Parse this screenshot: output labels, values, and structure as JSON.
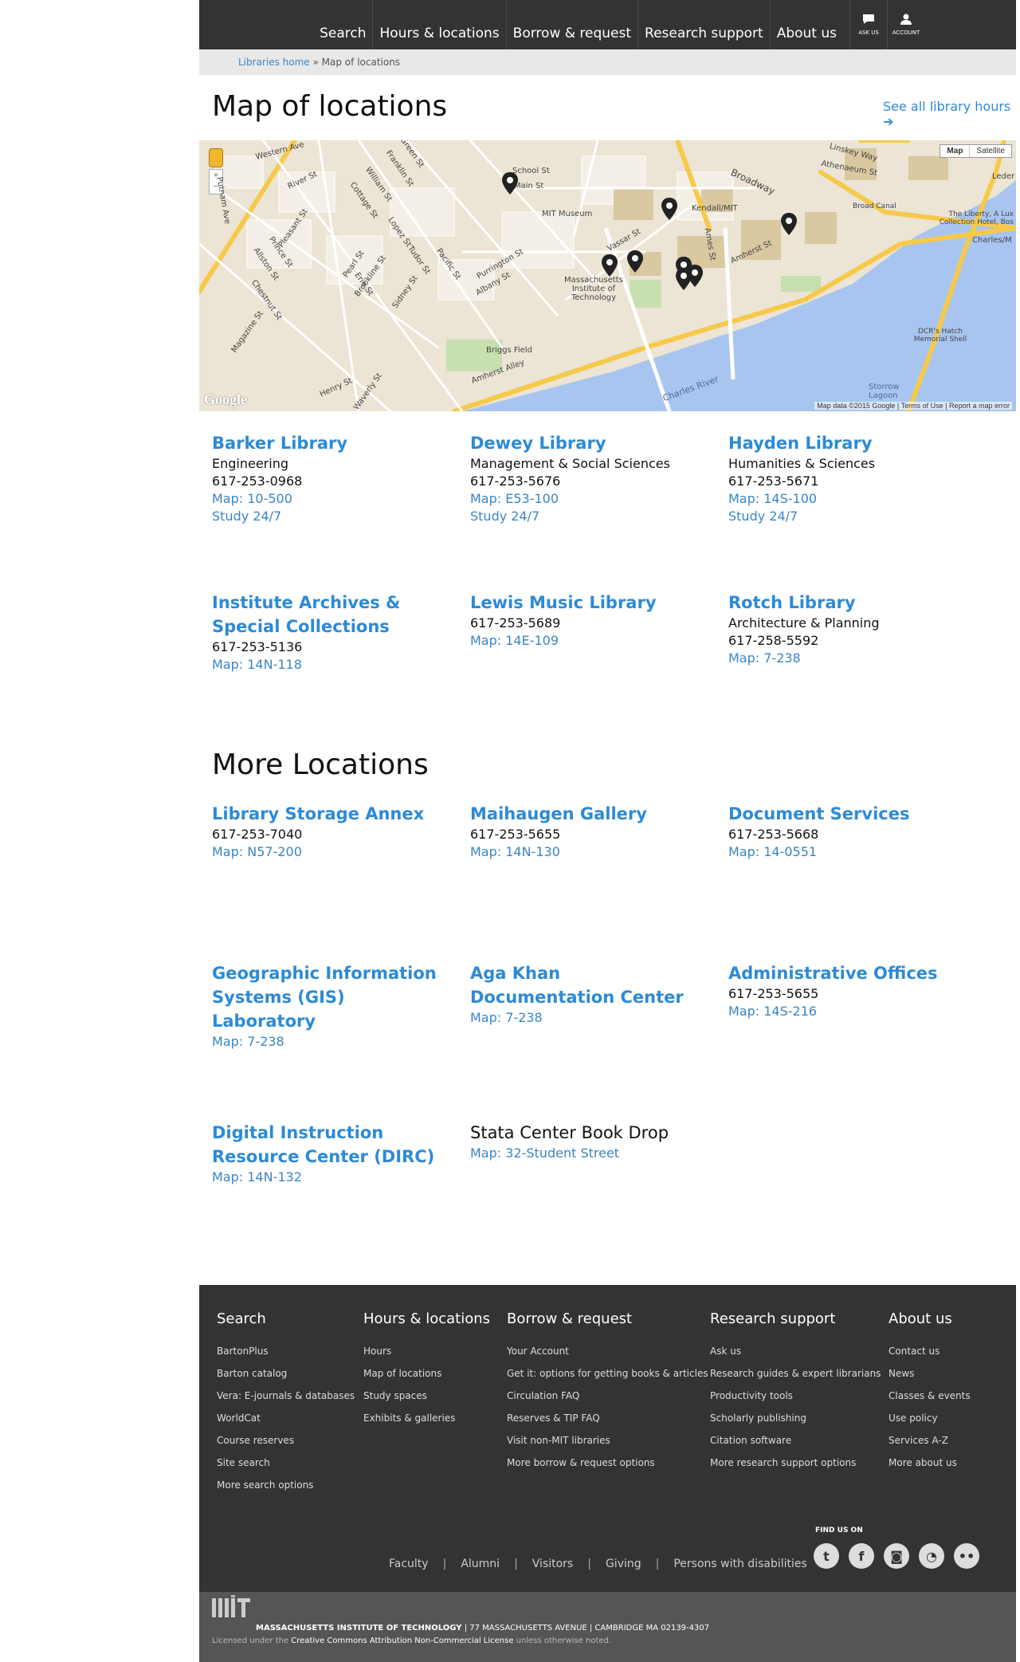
{
  "nav": {
    "items": [
      "Search",
      "Hours & locations",
      "Borrow & request",
      "Research support",
      "About us"
    ],
    "ask_us": "ASK US",
    "account": "ACCOUNT"
  },
  "breadcrumb": {
    "home": "Libraries home",
    "sep": "»",
    "current": "Map of locations"
  },
  "page_title": "Map of locations",
  "all_hours_link": "See all library hours",
  "map": {
    "toggle_map": "Map",
    "toggle_satellite": "Satellite",
    "credit": "Map data ©2015 Google | Terms of Use | Report a map error",
    "google": "Google",
    "labels": {
      "western_ave": "Western Ave",
      "river_st": "River St",
      "putnam_ave": "Putnam Ave",
      "pleasant_st": "Pleasant St",
      "prince_st": "Prince St",
      "allston_st": "Allston St",
      "chestnut_st": "Chestnut St",
      "magazine_st": "Magazine St",
      "green_st": "Green St",
      "franklin_st": "Franklin St",
      "william_st": "William St",
      "cottage_st": "Cottage St",
      "school_st": "School St",
      "main_st": "Main St",
      "mit_museum": "MIT Museum",
      "kendall": "Kendall/MIT",
      "broadway": "Broadway",
      "linskey": "Linskey Way",
      "athenaeum": "Athenaeum St",
      "broad_canal": "Broad Canal",
      "liberty": "The Liberty, A Lux Collection Hotel, Bos",
      "mit": "Massachusetts Institute of Technology",
      "vassar": "Vassar St",
      "amherst": "Amherst St",
      "ames": "Ames St",
      "purrington": "Purrington St",
      "albany": "Albany St",
      "briggs": "Briggs Field",
      "amherst_alley": "Amherst Alley",
      "charles_river": "Charles River",
      "dcr": "DCR's Hatch Memorial Shell",
      "storrow": "Storrow Lagoon",
      "charles_m": "Charles/M",
      "leder": "Leder",
      "henry": "Henry St",
      "waverly": "Waverly St",
      "brookline": "Brookline St",
      "sidney": "Sidney St",
      "pacific": "Pacific St",
      "tudor": "Tudor St",
      "pearl": "Pearl St",
      "erie": "Erie St",
      "lopez": "Lopez St"
    }
  },
  "libraries": [
    {
      "name": "Barker Library",
      "dept": "Engineering",
      "phone": "617-253-0968",
      "map": "Map: 10-500",
      "study": "Study 24/7"
    },
    {
      "name": "Dewey Library",
      "dept": "Management & Social Sciences",
      "phone": "617-253-5676",
      "map": "Map: E53-100",
      "study": "Study 24/7"
    },
    {
      "name": "Hayden Library",
      "dept": "Humanities & Sciences",
      "phone": "617-253-5671",
      "map": "Map: 14S-100",
      "study": "Study 24/7"
    },
    {
      "name": "Institute Archives & Special Collections",
      "phone": "617-253-5136",
      "map": "Map: 14N-118"
    },
    {
      "name": "Lewis Music Library",
      "phone": "617-253-5689",
      "map": "Map: 14E-109"
    },
    {
      "name": "Rotch Library",
      "dept": "Architecture & Planning",
      "phone": "617-258-5592",
      "map": "Map: 7-238"
    }
  ],
  "more_title": "More Locations",
  "more_locations": [
    {
      "name": "Library Storage Annex",
      "phone": "617-253-7040",
      "map": "Map: N57-200"
    },
    {
      "name": "Maihaugen Gallery",
      "phone": "617-253-5655",
      "map": "Map: 14N-130"
    },
    {
      "name": "Document Services",
      "phone": "617-253-5668",
      "map": "Map: 14-0551"
    },
    {
      "name": "Geographic Information Systems (GIS) Laboratory",
      "map": "Map: 7-238"
    },
    {
      "name": "Aga Khan Documentation Center",
      "map": "Map: 7-238"
    },
    {
      "name": "Administrative Offices",
      "phone": "617-253-5655",
      "map": "Map: 14S-216"
    },
    {
      "name": "Digital Instruction Resource Center (DIRC)",
      "map": "Map: 14N-132"
    },
    {
      "name": "Stata Center Book Drop",
      "map": "Map: 32-Student Street"
    }
  ],
  "footer": {
    "columns": [
      {
        "title": "Search",
        "links": [
          "BartonPlus",
          "Barton catalog",
          "Vera: E-journals & databases",
          "WorldCat",
          "Course reserves",
          "Site search",
          "More search options"
        ]
      },
      {
        "title": "Hours & locations",
        "links": [
          "Hours",
          "Map of locations",
          "Study spaces",
          "Exhibits & galleries"
        ]
      },
      {
        "title": "Borrow & request",
        "links": [
          "Your Account",
          "Get it: options for getting books & articles",
          "Circulation FAQ",
          "Reserves & TIP FAQ",
          "Visit non-MIT libraries",
          "More borrow & request options"
        ]
      },
      {
        "title": "Research support",
        "links": [
          "Ask us",
          "Research guides & expert librarians",
          "Productivity tools",
          "Scholarly publishing",
          "Citation software",
          "More research support options"
        ]
      },
      {
        "title": "About us",
        "links": [
          "Contact us",
          "News",
          "Classes & events",
          "Use policy",
          "Services A-Z",
          "More about us"
        ]
      }
    ],
    "audience_links": [
      "Faculty",
      "Alumni",
      "Visitors",
      "Giving",
      "Persons with disabilities"
    ],
    "find_us": "FIND US ON",
    "social": [
      "twitter-icon",
      "facebook-icon",
      "instagram-icon",
      "rss-icon",
      "flickr-icon"
    ],
    "mit_name": "MASSACHUSETTS INSTITUTE OF TECHNOLOGY",
    "mit_address": "| 77 MASSACHUSETTS AVENUE | CAMBRIDGE MA 02139-4307",
    "license_pre": "Licensed under the",
    "license_link": "Creative Commons Attribution Non-Commercial License",
    "license_post": "unless otherwise noted."
  }
}
